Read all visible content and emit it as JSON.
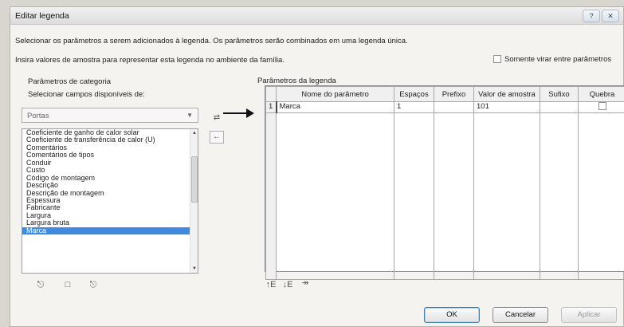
{
  "window": {
    "title": "Editar legenda",
    "help_label": "?",
    "close_label": "✕"
  },
  "instructions": {
    "line1": "Selecionar os parâmetros a serem adicionados à legenda. Os parâmetros serão combinados em uma legenda única.",
    "line2": "Insira valores de amostra para representar esta legenda no ambiente da família."
  },
  "only_flip_label": "Somente virar entre parâmetros",
  "category_params": {
    "heading": "Parâmetros de categoria",
    "fields_label": "Selecionar campos disponíveis de:",
    "combo_value": "Portas",
    "items": [
      "Coeficiente de ganho de calor solar",
      "Coeficiente de transferência de calor (U)",
      "Comentários",
      "Comentários de tipos",
      "Conduir",
      "Custo",
      "Código de montagem",
      "Descrição",
      "Descrição de montagem",
      "Espessura",
      "Fabricante",
      "Largura",
      "Largura bruta",
      "Marca"
    ],
    "selected_item": "Marca"
  },
  "legend_params": {
    "heading": "Parâmetros da legenda",
    "columns": [
      "Nome do parâmetro",
      "Espaços",
      "Prefixo",
      "Valor de amostra",
      "Sufixo",
      "Quebra"
    ],
    "rows": [
      {
        "row_number": "1",
        "name": "Marca",
        "spaces": "1",
        "prefix": "",
        "sample_value": "101",
        "suffix": "",
        "wrap": false
      }
    ]
  },
  "buttons": {
    "ok": "OK",
    "cancel": "Cancelar",
    "apply": "Aplicar"
  },
  "colors": {
    "selection": "#3e8ce0",
    "annotation_arrow": "#111111"
  }
}
